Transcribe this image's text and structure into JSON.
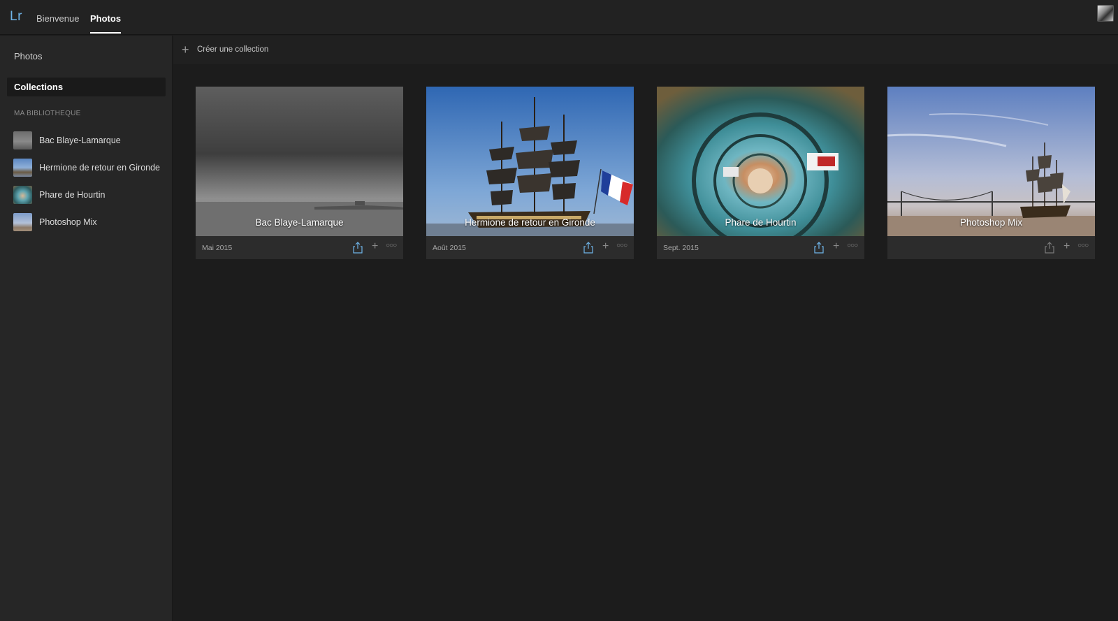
{
  "header": {
    "logo": "Lr",
    "tabs": [
      {
        "label": "Bienvenue",
        "active": false
      },
      {
        "label": "Photos",
        "active": true
      }
    ]
  },
  "sidebar": {
    "photos_label": "Photos",
    "collections_label": "Collections",
    "section_title": "MA BIBLIOTHEQUE",
    "items": [
      {
        "label": "Bac Blaye-Lamarque"
      },
      {
        "label": "Hermione de retour en Gironde"
      },
      {
        "label": "Phare de Hourtin"
      },
      {
        "label": "Photoshop Mix"
      }
    ]
  },
  "toolbar": {
    "create_label": "Créer une collection"
  },
  "collections": [
    {
      "title": "Bac Blaye-Lamarque",
      "date": "Mai 2015"
    },
    {
      "title": "Hermione de retour en Gironde",
      "date": "Août 2015"
    },
    {
      "title": "Phare de Hourtin",
      "date": "Sept. 2015"
    },
    {
      "title": "Photoshop Mix",
      "date": ""
    }
  ],
  "colors": {
    "accent": "#6fb4e8",
    "background": "#1c1c1c",
    "sidebar": "#262626"
  }
}
